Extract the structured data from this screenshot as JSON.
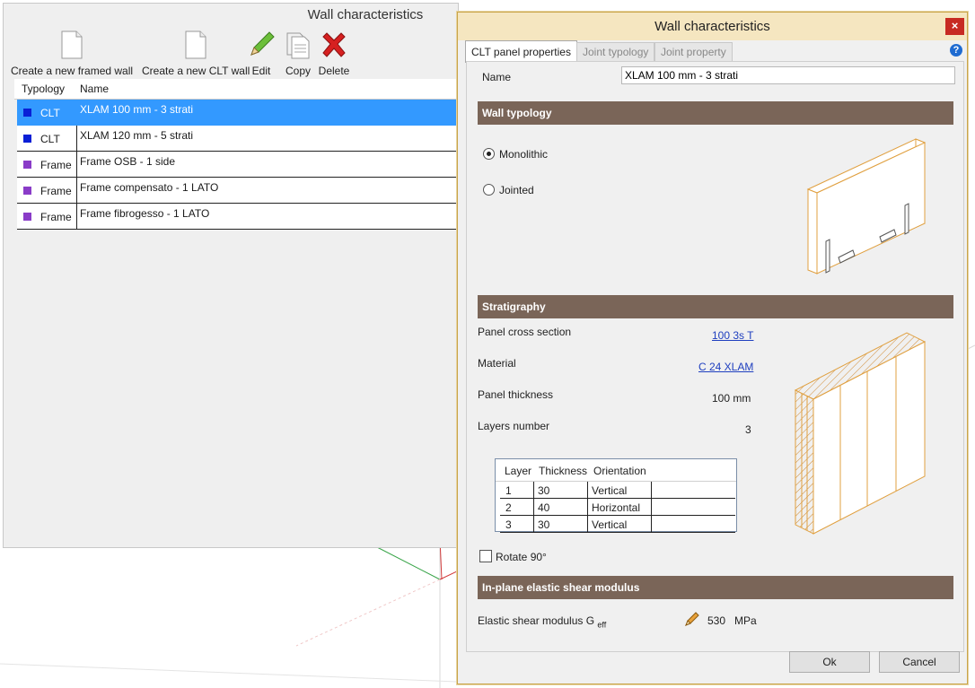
{
  "left_window": {
    "title": "Wall characteristics",
    "toolbar": {
      "new_framed_label": "Create a new framed wall",
      "new_clt_label": "Create a new CLT wall",
      "edit_label": "Edit",
      "copy_label": "Copy",
      "delete_label": "Delete"
    },
    "columns": {
      "typology": "Typology",
      "name": "Name"
    },
    "rows": [
      {
        "typology": "CLT",
        "name": "XLAM 100 mm - 3 strati",
        "color": "#0a1fd6",
        "selected": true
      },
      {
        "typology": "CLT",
        "name": "XLAM 120 mm - 5 strati",
        "color": "#0a1fd6",
        "selected": false
      },
      {
        "typology": "Frame",
        "name": "Frame OSB - 1 side",
        "color": "#8a3cc8",
        "selected": false
      },
      {
        "typology": "Frame",
        "name": "Frame compensato - 1 LATO",
        "color": "#8a3cc8",
        "selected": false
      },
      {
        "typology": "Frame",
        "name": "Frame fibrogesso - 1 LATO",
        "color": "#8a3cc8",
        "selected": false
      }
    ]
  },
  "dialog": {
    "title": "Wall characteristics",
    "close_symbol": "×",
    "tabs": [
      "CLT panel properties",
      "Joint typology",
      "Joint property"
    ],
    "active_tab": 0,
    "help_symbol": "?",
    "name_label": "Name",
    "name_value": "XLAM 100 mm - 3 strati",
    "wall_typology": {
      "header": "Wall typology",
      "options": [
        "Monolithic",
        "Jointed"
      ],
      "selected": "Monolithic"
    },
    "stratigraphy": {
      "header": "Stratigraphy",
      "panel_cross_section_label": "Panel cross section",
      "panel_cross_section_value": "100 3s T",
      "material_label": "Material",
      "material_value": "C 24 XLAM",
      "panel_thickness_label": "Panel thickness",
      "panel_thickness_value": "100 mm",
      "layers_number_label": "Layers number",
      "layers_number_value": "3",
      "table": {
        "headers": [
          "Layer",
          "Thickness",
          "Orientation"
        ],
        "rows": [
          [
            "1",
            "30",
            "Vertical"
          ],
          [
            "2",
            "40",
            "Horizontal"
          ],
          [
            "3",
            "30",
            "Vertical"
          ]
        ]
      },
      "rotate_label": "Rotate 90°",
      "rotate_checked": false
    },
    "shear": {
      "header": "In-plane elastic shear modulus",
      "label": "Elastic shear modulus G",
      "subscript": "eff",
      "value": "530",
      "unit": "MPa"
    },
    "ok_label": "Ok",
    "cancel_label": "Cancel"
  }
}
